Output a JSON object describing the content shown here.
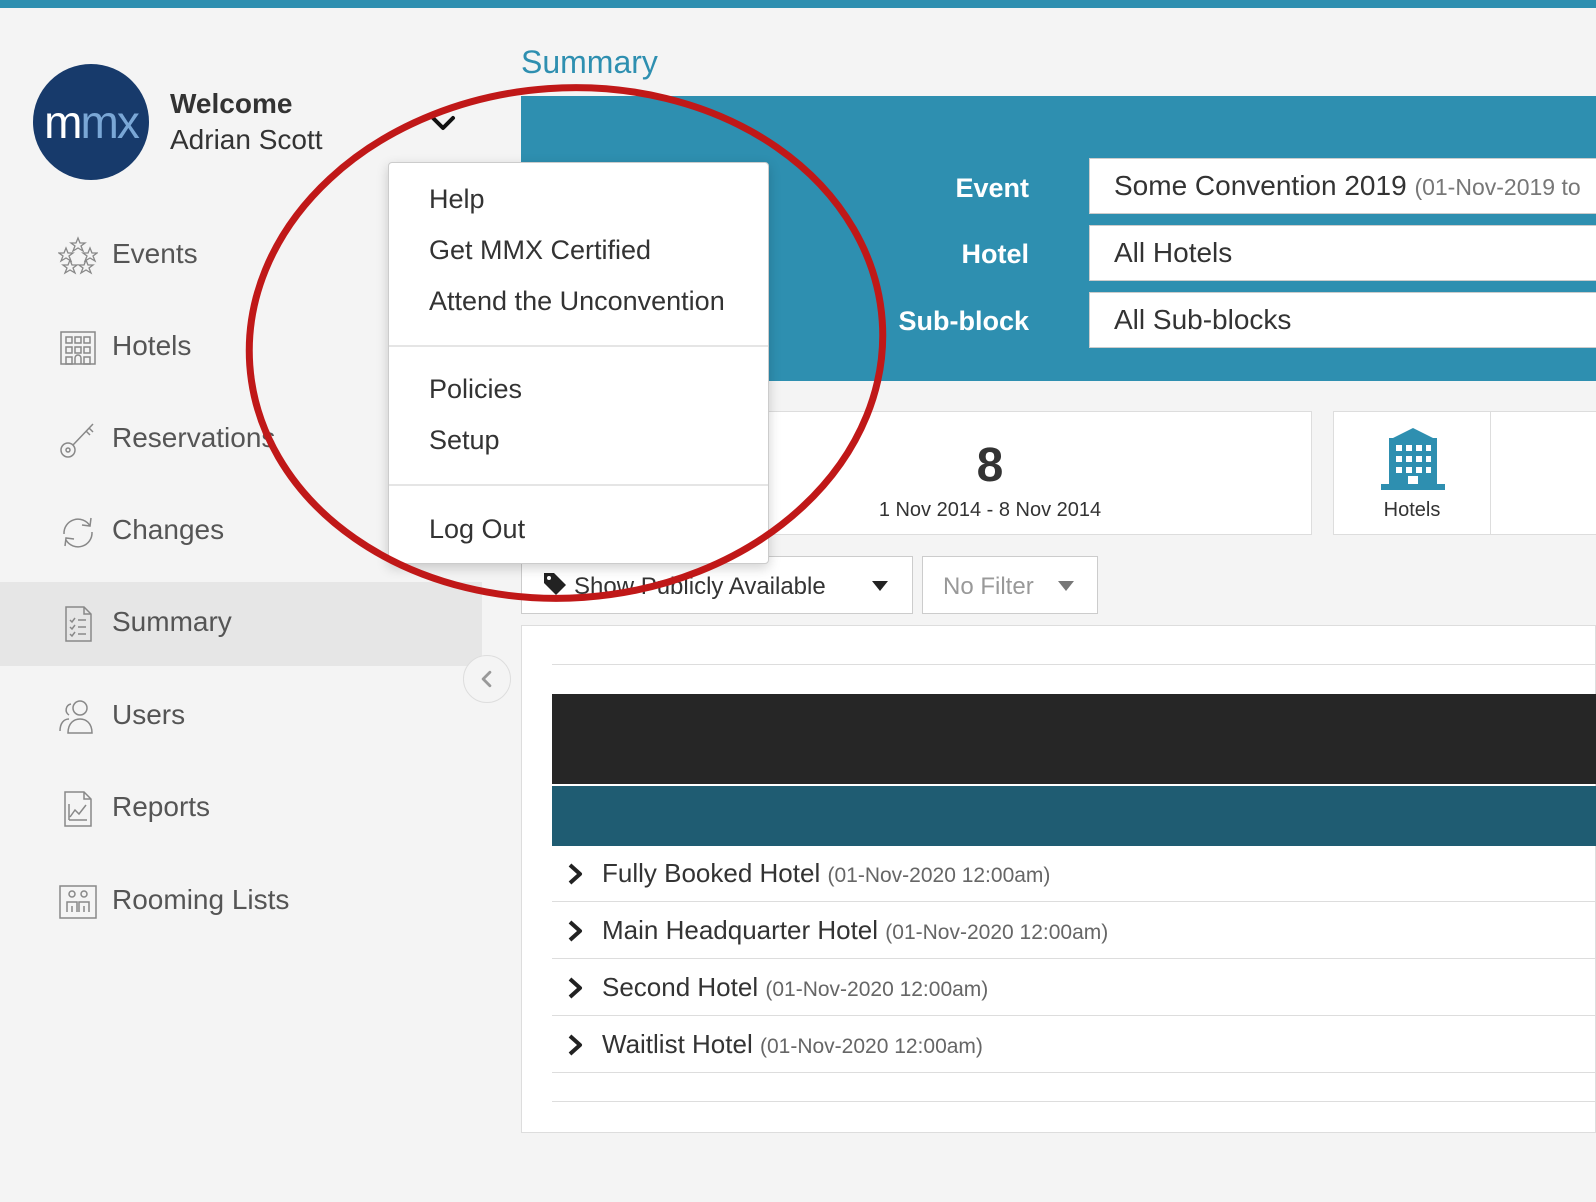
{
  "user": {
    "logo_text_m": "m",
    "logo_text_mx": "mx",
    "welcome": "Welcome",
    "name": "Adrian Scott"
  },
  "menu": {
    "items_group1": [
      "Help",
      "Get MMX Certified",
      "Attend the Unconvention"
    ],
    "items_group2": [
      "Policies",
      "Setup"
    ],
    "items_group3": [
      "Log Out"
    ]
  },
  "sidebar": {
    "items": [
      {
        "label": "Events",
        "icon": "stars-icon"
      },
      {
        "label": "Hotels",
        "icon": "building-icon"
      },
      {
        "label": "Reservations",
        "icon": "key-icon"
      },
      {
        "label": "Changes",
        "icon": "refresh-icon"
      },
      {
        "label": "Summary",
        "icon": "checklist-icon",
        "active": true
      },
      {
        "label": "Users",
        "icon": "users-icon"
      },
      {
        "label": "Reports",
        "icon": "chart-icon"
      },
      {
        "label": "Rooming Lists",
        "icon": "rooming-icon"
      }
    ]
  },
  "page": {
    "title": "Summary"
  },
  "filters": {
    "event_label": "Event",
    "event_value": "Some Convention 2019",
    "event_dates": "(01-Nov-2019 to",
    "hotel_label": "Hotel",
    "hotel_value": "All Hotels",
    "subblock_label": "Sub-block",
    "subblock_value": "All Sub-blocks"
  },
  "stats": {
    "nights": "8",
    "date_range": "1 Nov 2014 - 8 Nov 2014",
    "hotels_label": "Hotels"
  },
  "controls": {
    "tag_filter": "Show Publicly Available",
    "no_filter": "No Filter"
  },
  "hotels": [
    {
      "name": "Fully Booked Hotel",
      "date": "(01-Nov-2020 12:00am)"
    },
    {
      "name": "Main Headquarter Hotel",
      "date": "(01-Nov-2020 12:00am)"
    },
    {
      "name": "Second Hotel",
      "date": "(01-Nov-2020 12:00am)"
    },
    {
      "name": "Waitlist Hotel",
      "date": "(01-Nov-2020 12:00am)"
    }
  ],
  "colors": {
    "accent": "#2e8fb0",
    "annotation": "#c01818",
    "dark_band": "#262626",
    "teal_band": "#1f5c72"
  }
}
